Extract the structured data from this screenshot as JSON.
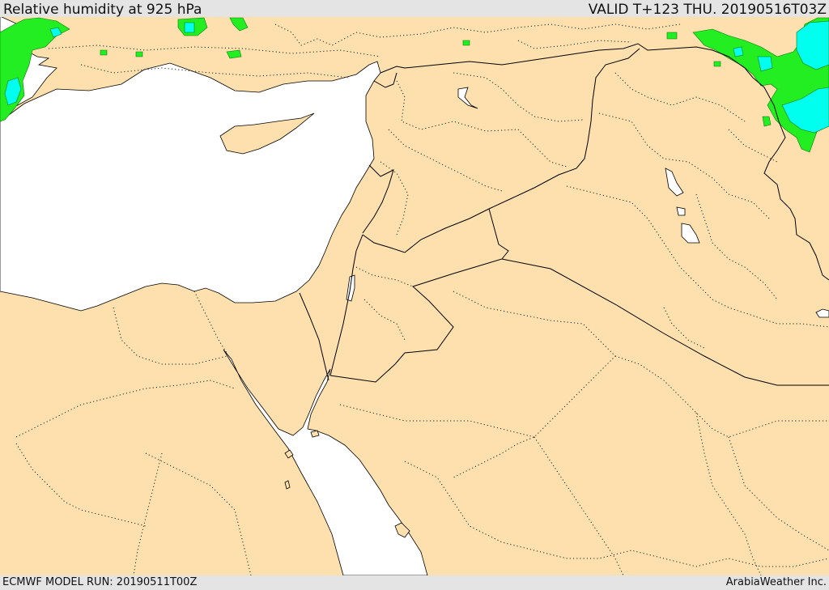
{
  "header": {
    "title": "Relative humidity at 925 hPa",
    "valid": "VALID T+123 THU. 20190516T03Z"
  },
  "footer": {
    "model_run": "ECMWF MODEL RUN: 20190511T00Z",
    "credit": "ArabiaWeather Inc."
  },
  "colors": {
    "land": "#fde0ad",
    "water": "#ffffff",
    "humidity_high": "#22ee22",
    "humidity_very_high": "#00ffee",
    "background_bar": "#e4e4e4"
  }
}
